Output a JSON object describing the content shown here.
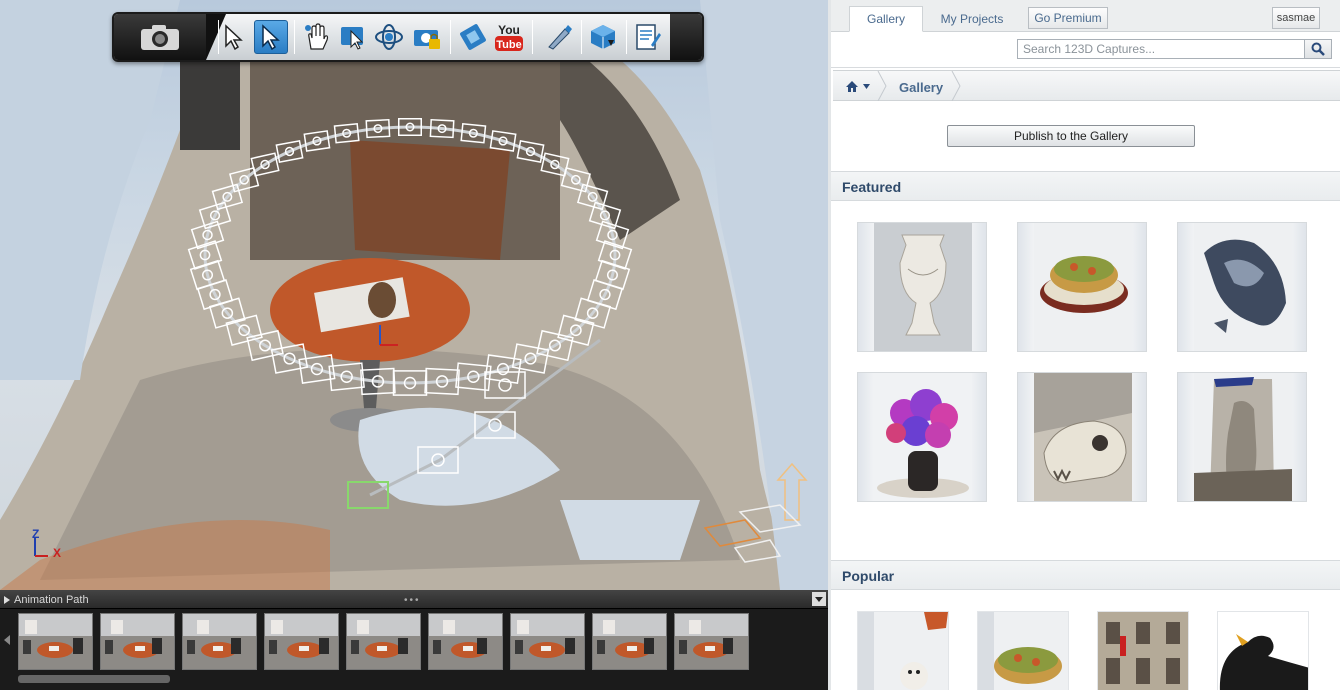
{
  "toolbar": {
    "tools": [
      "camera-menu",
      "select-tool",
      "select-active-tool",
      "pan-tool",
      "edit-tool",
      "orbit-tool",
      "lock-camera-tool",
      "film-tool",
      "youtube-export",
      "brush-tool",
      "cube-export",
      "notes-tool"
    ],
    "youtube_top": "You",
    "youtube_bottom": "Tube"
  },
  "axis": {
    "z": "Z",
    "x": "X"
  },
  "strip": {
    "title": "Animation Path",
    "dots": "•••",
    "frame_count": 9
  },
  "panel": {
    "tabs": [
      "Gallery",
      "My Projects"
    ],
    "premium_label": "Go Premium",
    "username": "sasmae",
    "search_placeholder": "Search 123D Captures...",
    "breadcrumb": {
      "current": "Gallery"
    },
    "publish_label": "Publish to the Gallery",
    "featured_title": "Featured",
    "featured": [
      "urn-model",
      "quiche-model",
      "rock-sculpture-model",
      "flower-bouquet-model",
      "skull-model",
      "statue-model"
    ],
    "popular_title": "Popular",
    "popular": [
      "teddy-model",
      "quiche-model-2",
      "building-facade-model",
      "bird-model"
    ]
  },
  "colors": {
    "accent_blue": "#4a6a8e",
    "heading_blue": "#2f4a6a",
    "table_orange": "#c0582a"
  }
}
